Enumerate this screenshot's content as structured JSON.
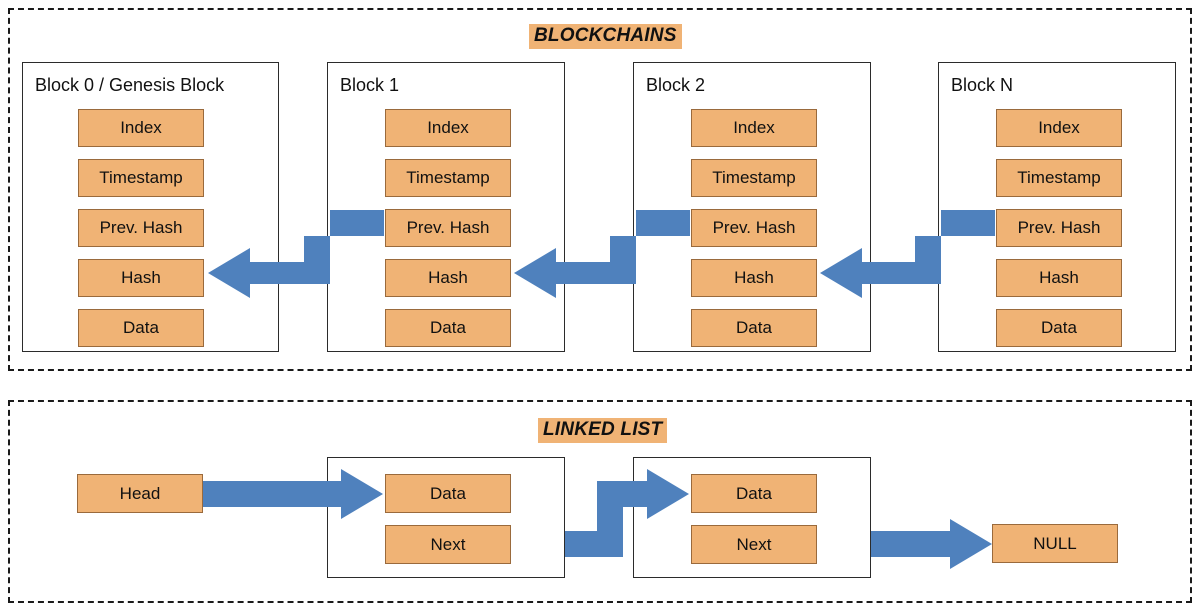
{
  "diagram": {
    "sections": [
      {
        "id": "blockchains",
        "title": "BLOCKCHAINS",
        "blocks": [
          {
            "title": "Block 0 / Genesis Block",
            "fields": [
              "Index",
              "Timestamp",
              "Prev. Hash",
              "Hash",
              "Data"
            ]
          },
          {
            "title": "Block 1",
            "fields": [
              "Index",
              "Timestamp",
              "Prev. Hash",
              "Hash",
              "Data"
            ]
          },
          {
            "title": "Block 2",
            "fields": [
              "Index",
              "Timestamp",
              "Prev. Hash",
              "Hash",
              "Data"
            ]
          },
          {
            "title": "Block N",
            "fields": [
              "Index",
              "Timestamp",
              "Prev. Hash",
              "Hash",
              "Data"
            ]
          }
        ]
      },
      {
        "id": "linked_list",
        "title": "LINKED LIST",
        "head_label": "Head",
        "null_label": "NULL",
        "nodes": [
          {
            "fields": [
              "Data",
              "Next"
            ]
          },
          {
            "fields": [
              "Data",
              "Next"
            ]
          }
        ]
      }
    ],
    "colors": {
      "box_fill": "#f0b375",
      "box_border": "#9a6a3c",
      "arrow": "#4f81bd",
      "card_border": "#2b2b2b",
      "section_border": "#1a1a1a",
      "text": "#111111",
      "background": "#ffffff"
    }
  }
}
